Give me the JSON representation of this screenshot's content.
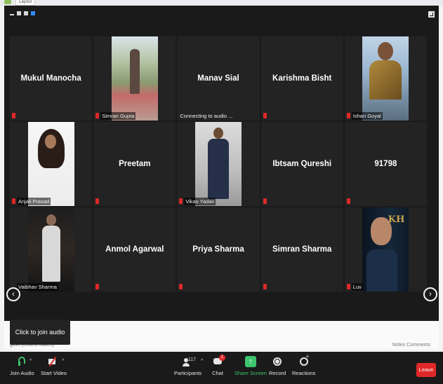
{
  "browser": {
    "tab_label": "Layout"
  },
  "grid": {
    "tiles": [
      {
        "name": "Mukul Manocha",
        "label": ""
      },
      {
        "name": "",
        "label": "Simran Gupta"
      },
      {
        "name": "Manav Sial",
        "label": "Connecting to audio ..."
      },
      {
        "name": "Karishma Bisht",
        "label": ""
      },
      {
        "name": "",
        "label": "Ishan Goyal"
      },
      {
        "name": "",
        "label": "Anjali Prasad"
      },
      {
        "name": "Preetam",
        "label": ""
      },
      {
        "name": "",
        "label": "Vikas Yadav"
      },
      {
        "name": "Ibtsam Qureshi",
        "label": ""
      },
      {
        "name": "91798",
        "label": ""
      },
      {
        "name": "",
        "label": "Vaibhav Sharma"
      },
      {
        "name": "Anmol Agarwal",
        "label": ""
      },
      {
        "name": "Priya Sharma",
        "label": ""
      },
      {
        "name": "Simran Sharma",
        "label": ""
      },
      {
        "name": "",
        "label": "Luv"
      }
    ]
  },
  "nav": {
    "prev": "‹",
    "next": "›"
  },
  "tooltip": {
    "text": "Click to join audio"
  },
  "status_bar": {
    "language": "glish (United States)",
    "right": "Notes   Comments"
  },
  "toolbar": {
    "join_audio": "Join Audio",
    "start_video": "Start Video",
    "participants": "Participants",
    "participants_count": "117",
    "chat": "Chat",
    "chat_badge": "1",
    "share_screen": "Share Screen",
    "record": "Record",
    "reactions": "Reactions",
    "leave": "Leave"
  },
  "colors": {
    "accent_green": "#3ec46d",
    "leave_red": "#e02828",
    "badge_red": "#e02828"
  }
}
